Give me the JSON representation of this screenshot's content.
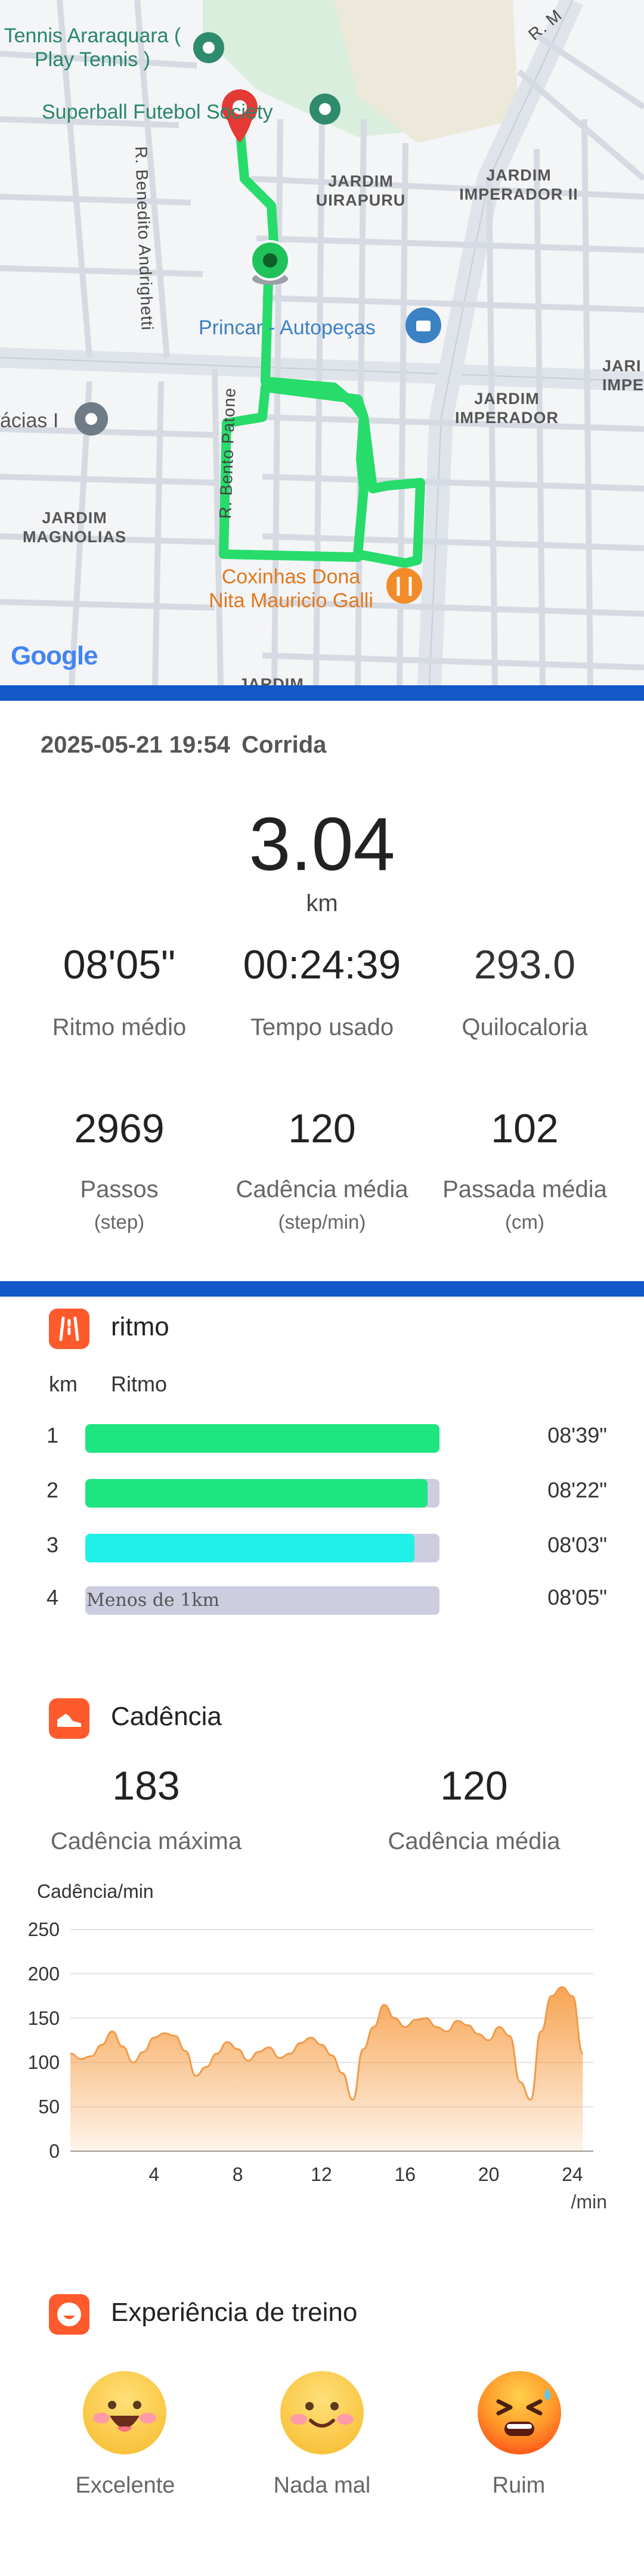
{
  "map": {
    "pois": [
      {
        "name": "tennis",
        "text": "Tennis Araraquara\n( Play Tennis )"
      },
      {
        "name": "superball",
        "text": "Superball Futebol Society"
      },
      {
        "name": "princar",
        "text": "Princar - Autopeças"
      },
      {
        "name": "acacias",
        "text": "ácias I"
      },
      {
        "name": "coxinhas",
        "text": "Coxinhas Dona\nNita Mauricio Galli"
      }
    ],
    "areas": {
      "uirapuru": "JARDIM\nUIRAPURU",
      "imperador2": "JARDIM\nIMPERADOR II",
      "imperador": "JARDIM\nIMPERADOR",
      "magnolias": "JARDIM\nMAGNOLIAS",
      "jard_right": "JARI\nIMPE",
      "jardim_bottom": "JARDIM"
    },
    "streets": {
      "benedito": "R. Benedito Andrighetti",
      "bento": "R. Bento Patone",
      "top_right": "R. M"
    },
    "google": "Google"
  },
  "summary": {
    "datetime": "2025-05-21 19:54",
    "activity": "Corrida",
    "distance": "3.04",
    "distance_unit": "km",
    "stats_row1": [
      {
        "value": "08'05\"",
        "label": "Ritmo médio"
      },
      {
        "value": "00:24:39",
        "label": "Tempo usado"
      },
      {
        "value": "293.0",
        "label": "Quilocaloria"
      }
    ],
    "stats_row2": [
      {
        "value": "2969",
        "label": "Passos",
        "unit": "(step)"
      },
      {
        "value": "120",
        "label": "Cadência média",
        "unit": "(step/min)"
      },
      {
        "value": "102",
        "label": "Passada média",
        "unit": "(cm)"
      }
    ]
  },
  "pace": {
    "title": "ritmo",
    "col_km": "km",
    "col_pace": "Ritmo",
    "rows": [
      {
        "km": "1",
        "time": "08'39\"",
        "fraction": 1.0,
        "color": "#1de57f",
        "note": ""
      },
      {
        "km": "2",
        "time": "08'22\"",
        "fraction": 0.967,
        "color": "#1de57f",
        "note": ""
      },
      {
        "km": "3",
        "time": "08'03\"",
        "fraction": 0.93,
        "color": "#1ff0e8",
        "note": ""
      },
      {
        "km": "4",
        "time": "08'05\"",
        "fraction": 0.0,
        "color": "#cdcde0",
        "note": "Menos de 1km"
      }
    ]
  },
  "cadence": {
    "title": "Cadência",
    "max_value": "183",
    "max_label": "Cadência máxima",
    "avg_value": "120",
    "avg_label": "Cadência média",
    "chart_data": {
      "type": "area",
      "ylabel": "Cadência/min",
      "xlabel": "/min",
      "ylim": [
        0,
        250
      ],
      "yticks": [
        0,
        50,
        100,
        150,
        200,
        250
      ],
      "xticks": [
        4,
        8,
        12,
        16,
        20,
        24
      ],
      "xlim": [
        0,
        25
      ],
      "x": [
        0,
        0.5,
        1,
        1.5,
        2,
        2.5,
        3,
        3.5,
        4,
        4.5,
        5,
        5.5,
        6,
        6.5,
        7,
        7.5,
        8,
        8.5,
        9,
        9.5,
        10,
        10.5,
        11,
        11.5,
        12,
        12.5,
        13,
        13.5,
        14,
        14.5,
        15,
        15.5,
        16,
        16.5,
        17,
        17.5,
        18,
        18.5,
        19,
        19.5,
        20,
        20.5,
        21,
        21.5,
        22,
        22.5,
        23,
        23.5,
        24,
        24.5
      ],
      "y": [
        110,
        104,
        107,
        120,
        135,
        118,
        100,
        112,
        128,
        133,
        130,
        113,
        85,
        95,
        110,
        123,
        115,
        102,
        112,
        117,
        105,
        110,
        122,
        128,
        120,
        108,
        88,
        58,
        115,
        140,
        165,
        150,
        140,
        148,
        150,
        140,
        135,
        147,
        142,
        132,
        125,
        140,
        130,
        78,
        58,
        135,
        175,
        185,
        175,
        110
      ],
      "color": "#f7a04a"
    }
  },
  "experience": {
    "title": "Experiência de treino",
    "options": [
      {
        "label": "Excelente"
      },
      {
        "label": "Nada mal"
      },
      {
        "label": "Ruim"
      }
    ]
  }
}
